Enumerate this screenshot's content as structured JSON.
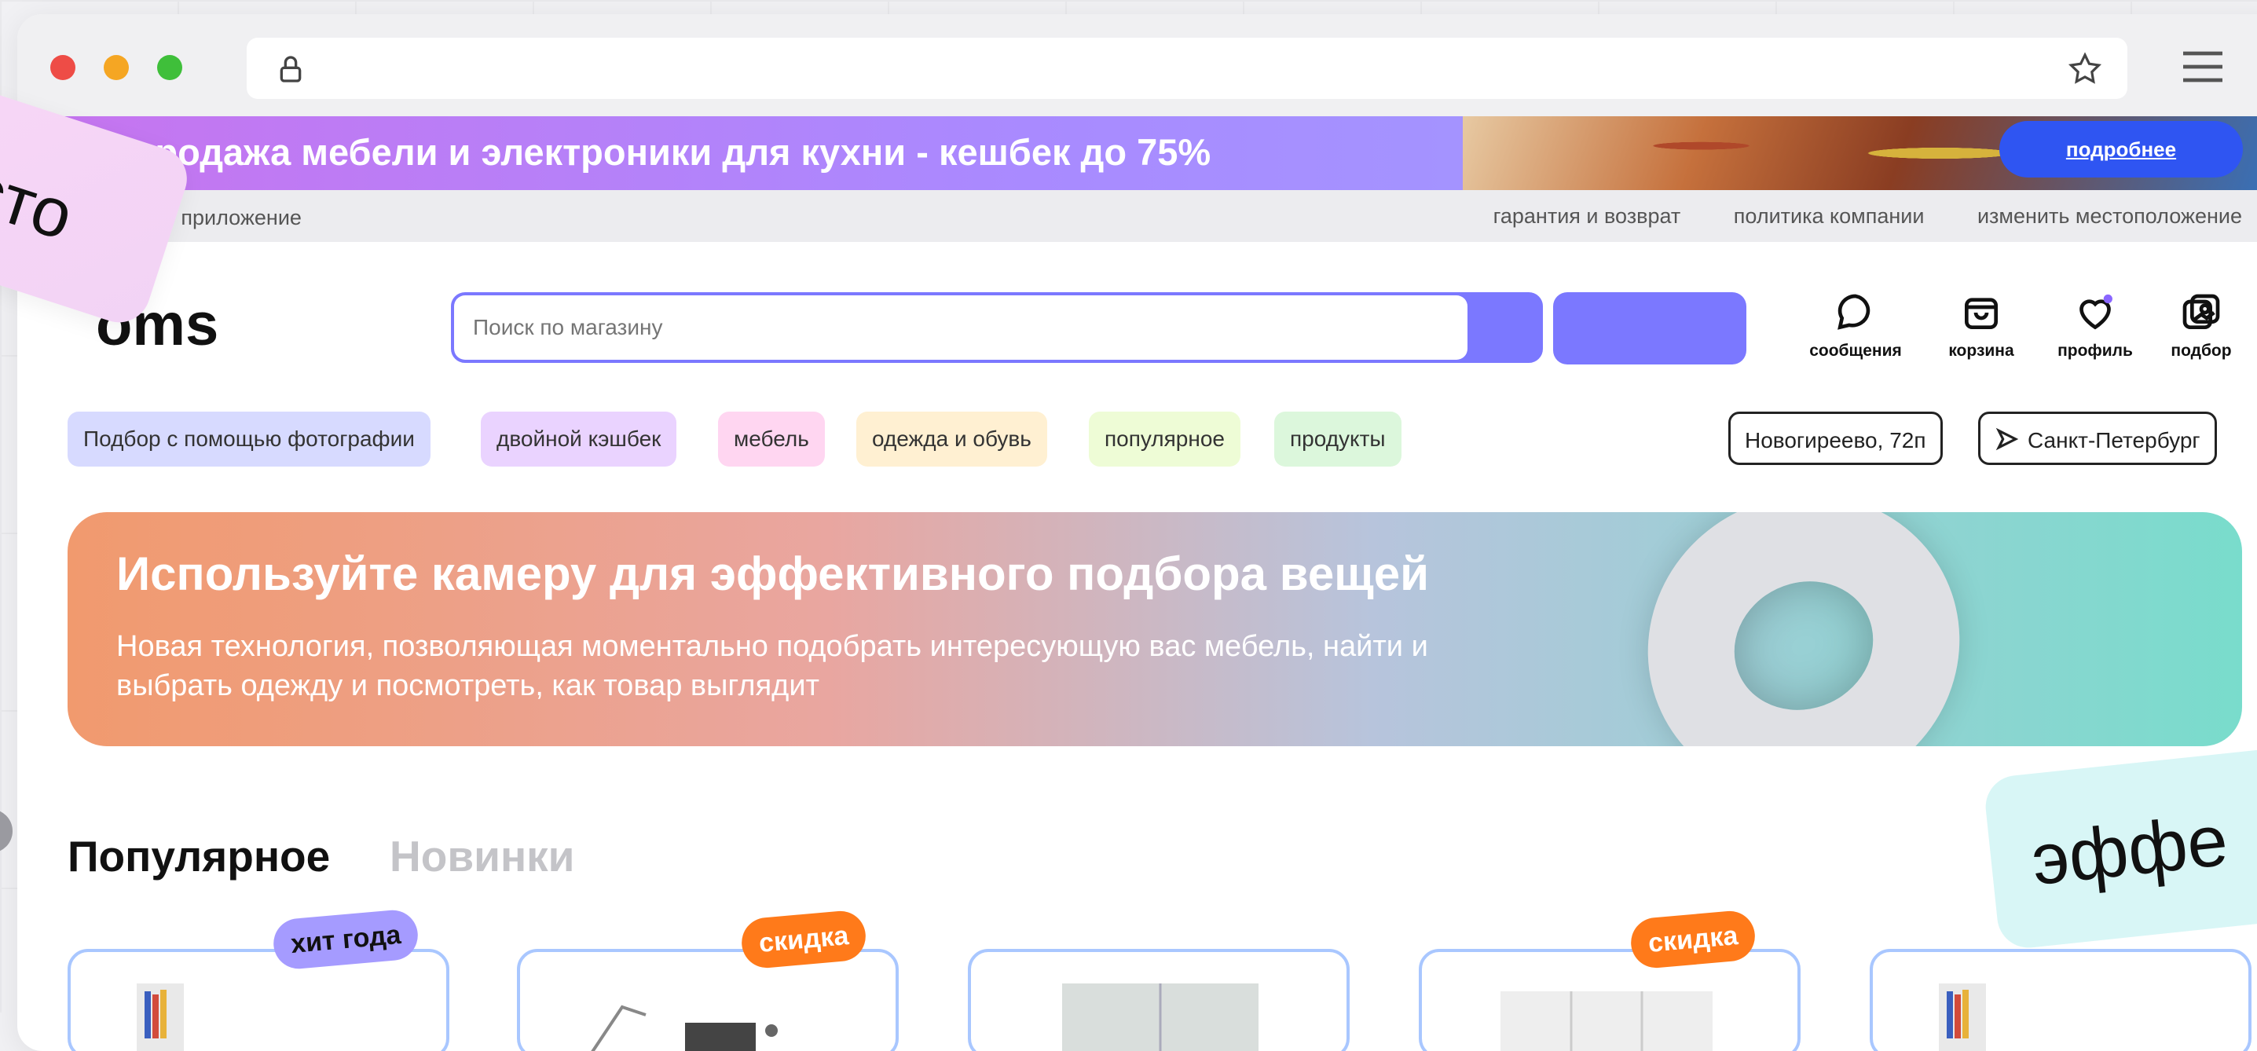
{
  "promo": {
    "text": "Распродажа мебели и электроники для кухни - кешбек до 75%",
    "button_label": "подробнее"
  },
  "subbar": {
    "download_app": "ать приложение",
    "links": [
      "гарантия и возврат",
      "политика компании",
      "изменить местоположение"
    ]
  },
  "header": {
    "logo": "oms",
    "search_placeholder": "Поиск по магазину",
    "icons": [
      {
        "name": "message-icon",
        "label": "сообщения"
      },
      {
        "name": "cart-icon",
        "label": "корзина"
      },
      {
        "name": "heart-icon",
        "label": "профиль"
      },
      {
        "name": "photo-search-icon",
        "label": "подбор"
      }
    ]
  },
  "chips": [
    {
      "label": "Подбор с помощью фотографии",
      "color": "#d7daff"
    },
    {
      "label": "двойной кэшбек",
      "color": "#ead3ff"
    },
    {
      "label": "мебель",
      "color": "#ffd6f1"
    },
    {
      "label": "одежда и обувь",
      "color": "#fff0d2"
    },
    {
      "label": "популярное",
      "color": "#eefcd6"
    },
    {
      "label": "продукты",
      "color": "#dcf7dc"
    }
  ],
  "location": {
    "address": "Новогиреево, 72п",
    "city": "Санкт-Петербург"
  },
  "hero": {
    "title": "Используйте камеру для эффективного подбора вещей",
    "subtitle": "Новая технология, позволяющая моментально подобрать интересующую вас мебель, найти и выбрать одежду и посмотреть, как товар выглядит"
  },
  "tabs": [
    {
      "label": "Популярное",
      "active": true
    },
    {
      "label": "Новинки",
      "active": false
    }
  ],
  "badges": {
    "hit": "хит года",
    "discount": "скидка"
  },
  "stickers": {
    "left": "сто",
    "right": "эффе"
  },
  "colors": {
    "accent": "#7b78ff",
    "promo_button": "#2f55f2",
    "badge_orange": "#ff7a1a",
    "badge_purple": "#a59bff"
  }
}
